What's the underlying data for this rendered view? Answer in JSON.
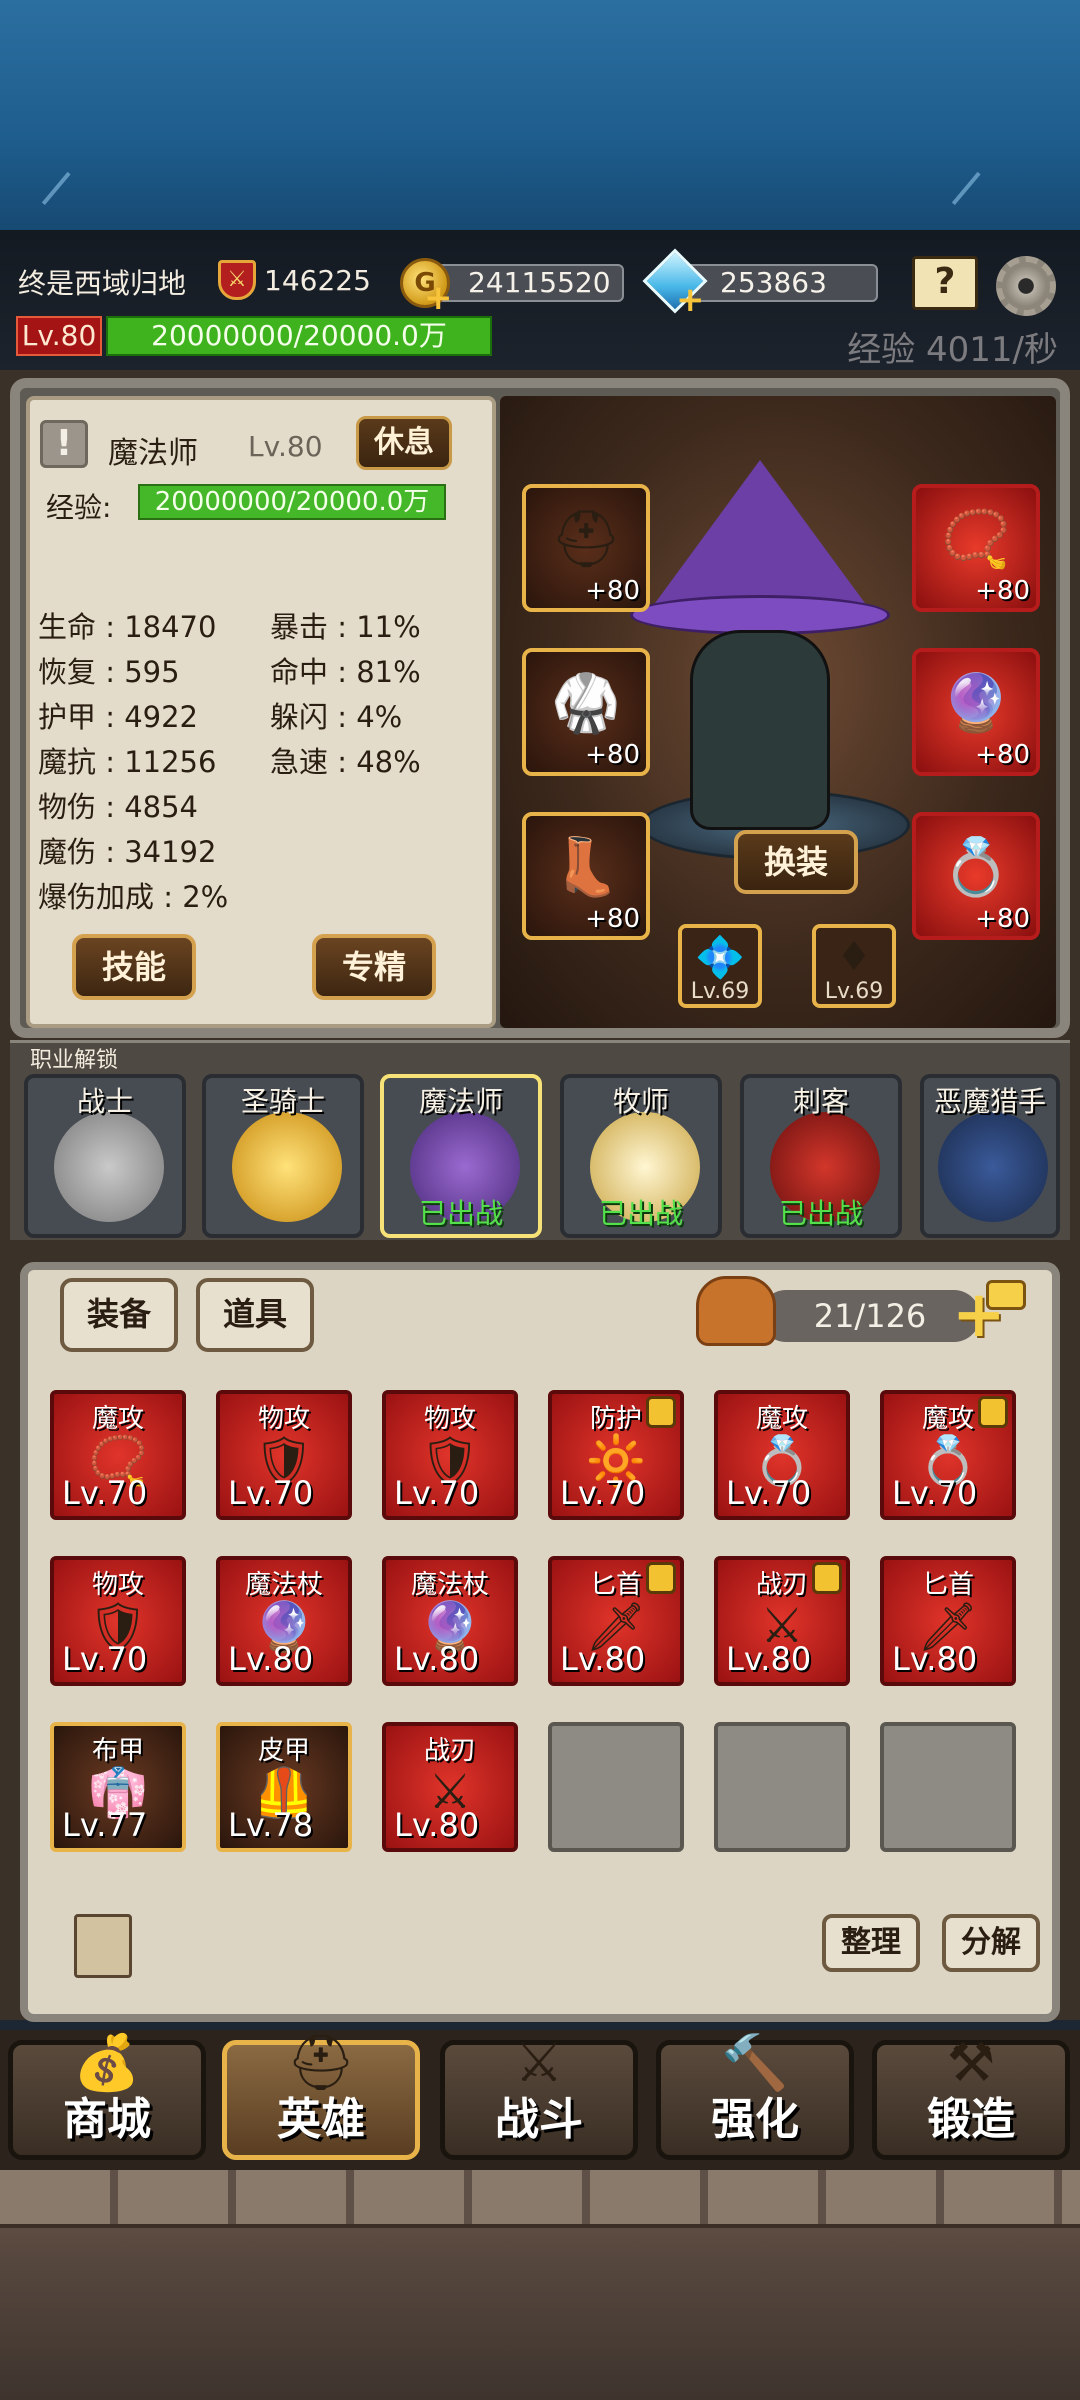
{
  "header": {
    "player_name": "终是西域归地",
    "power": "146225",
    "gold": "24115520",
    "diamonds": "253863",
    "level": "Lv.80",
    "exp": "20000000/20000.0万",
    "exp_rate": "经验 4011/秒"
  },
  "hero": {
    "class_name": "魔法师",
    "level": "Lv.80",
    "rest_label": "休息",
    "exp_label": "经验:",
    "exp": "20000000/20000.0万",
    "stats_left": [
      "生命 : 18470",
      "恢复 : 595",
      "护甲 : 4922",
      "魔抗 : 11256",
      "物伤 : 4854",
      "魔伤 : 34192",
      "爆伤加成 : 2%"
    ],
    "stats_right": [
      "暴击 : 11%",
      "命中 : 81%",
      "躲闪 : 4%",
      "急速 : 48%"
    ],
    "skill_label": "技能",
    "specialize_label": "专精",
    "change_label": "换装",
    "equipment_left": [
      {
        "icon": "helmet-icon",
        "plus": "+80"
      },
      {
        "icon": "armor-icon",
        "plus": "+80"
      },
      {
        "icon": "boots-icon",
        "plus": "+80"
      }
    ],
    "equipment_right": [
      {
        "icon": "necklace-icon",
        "plus": "+80"
      },
      {
        "icon": "weapon-icon",
        "plus": "+80"
      },
      {
        "icon": "ring-icon",
        "plus": "+80"
      }
    ],
    "gems": [
      {
        "icon": "blue-gem-icon",
        "lv": "Lv.69"
      },
      {
        "icon": "red-gem-icon",
        "lv": "Lv.69"
      }
    ]
  },
  "classes": {
    "label": "职业解锁",
    "items": [
      {
        "name": "战士",
        "status": ""
      },
      {
        "name": "圣骑士",
        "status": ""
      },
      {
        "name": "魔法师",
        "status": "已出战"
      },
      {
        "name": "牧师",
        "status": "已出战"
      },
      {
        "name": "刺客",
        "status": "已出战"
      },
      {
        "name": "恶魔猎手",
        "status": ""
      }
    ]
  },
  "bag": {
    "tab_equipment": "装备",
    "tab_items": "道具",
    "count": "21/126",
    "sort_label": "整理",
    "decompose_label": "分解",
    "items": [
      {
        "type": "魔攻",
        "lv": "Lv.70",
        "style": "red",
        "locked": false,
        "icon": "necklace-icon"
      },
      {
        "type": "物攻",
        "lv": "Lv.70",
        "style": "red",
        "locked": false,
        "icon": "bracer-icon"
      },
      {
        "type": "物攻",
        "lv": "Lv.70",
        "style": "red",
        "locked": false,
        "icon": "bracer-icon"
      },
      {
        "type": "防护",
        "lv": "Lv.70",
        "style": "red",
        "locked": true,
        "icon": "amulet-icon"
      },
      {
        "type": "魔攻",
        "lv": "Lv.70",
        "style": "red",
        "locked": false,
        "icon": "ring-icon"
      },
      {
        "type": "魔攻",
        "lv": "Lv.70",
        "style": "red",
        "locked": true,
        "icon": "ring-icon"
      },
      {
        "type": "物攻",
        "lv": "Lv.70",
        "style": "red",
        "locked": false,
        "icon": "bracer-icon"
      },
      {
        "type": "魔法杖",
        "lv": "Lv.80",
        "style": "red",
        "locked": false,
        "icon": "staff-icon"
      },
      {
        "type": "魔法杖",
        "lv": "Lv.80",
        "style": "red",
        "locked": false,
        "icon": "staff-icon"
      },
      {
        "type": "匕首",
        "lv": "Lv.80",
        "style": "red",
        "locked": true,
        "icon": "dagger-icon"
      },
      {
        "type": "战刃",
        "lv": "Lv.80",
        "style": "red",
        "locked": true,
        "icon": "blade-icon"
      },
      {
        "type": "匕首",
        "lv": "Lv.80",
        "style": "red",
        "locked": false,
        "icon": "dagger-icon"
      },
      {
        "type": "布甲",
        "lv": "Lv.77",
        "style": "gold",
        "locked": false,
        "icon": "robe-icon"
      },
      {
        "type": "皮甲",
        "lv": "Lv.78",
        "style": "gold",
        "locked": false,
        "icon": "leather-armor-icon"
      },
      {
        "type": "战刃",
        "lv": "Lv.80",
        "style": "red",
        "locked": false,
        "icon": "blade-icon"
      },
      {
        "type": "",
        "lv": "",
        "style": "empty",
        "locked": false,
        "icon": ""
      },
      {
        "type": "",
        "lv": "",
        "style": "empty",
        "locked": false,
        "icon": ""
      },
      {
        "type": "",
        "lv": "",
        "style": "empty",
        "locked": false,
        "icon": ""
      }
    ]
  },
  "nav": {
    "shop": "商城",
    "hero": "英雄",
    "battle": "战斗",
    "enhance": "强化",
    "forge": "锻造"
  }
}
